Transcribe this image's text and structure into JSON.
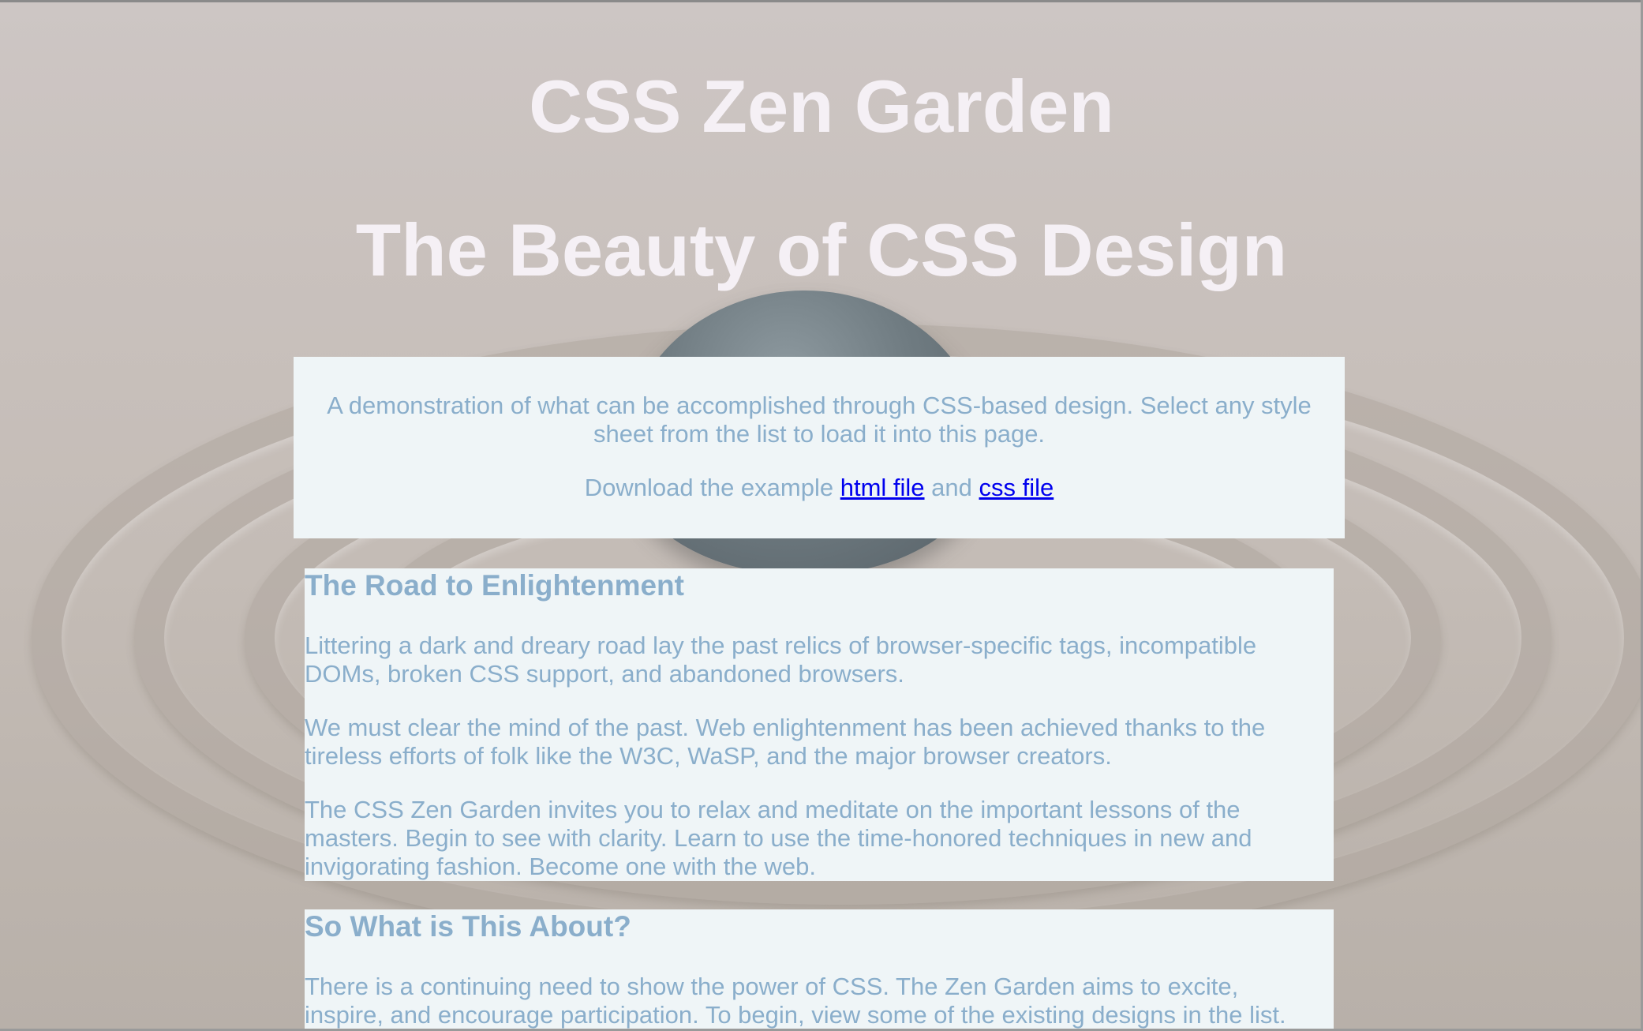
{
  "header": {
    "title": "CSS Zen Garden",
    "subtitle": "The Beauty of CSS Design"
  },
  "preamble": {
    "intro": "A demonstration of what can be accomplished through CSS-based design. Select any style sheet from the list to load it into this page.",
    "download_prefix": "Download the example",
    "html_link": "html file",
    "conjunction": "and",
    "css_link": "css file"
  },
  "road": {
    "heading": "The Road to Enlightenment",
    "paragraphs": [
      "Littering a dark and dreary road lay the past relics of browser-specific tags, incompatible DOMs, broken CSS support, and abandoned browsers.",
      "We must clear the mind of the past. Web enlightenment has been achieved thanks to the tireless efforts of folk like the W3C, WaSP, and the major browser creators.",
      "The CSS Zen Garden invites you to relax and meditate on the important lessons of the masters. Begin to see with clarity. Learn to use the time-honored techniques in new and invigorating fashion. Become one with the web."
    ]
  },
  "about": {
    "heading": "So What is This About?",
    "paragraphs": [
      "There is a continuing need to show the power of CSS. The Zen Garden aims to excite, inspire, and encourage participation. To begin, view some of the existing designs in the list."
    ]
  },
  "colors": {
    "title_text": "#f5f0f5",
    "panel_background": "#eff5f7",
    "panel_text": "#8aaecb",
    "link": "#0000ee"
  }
}
